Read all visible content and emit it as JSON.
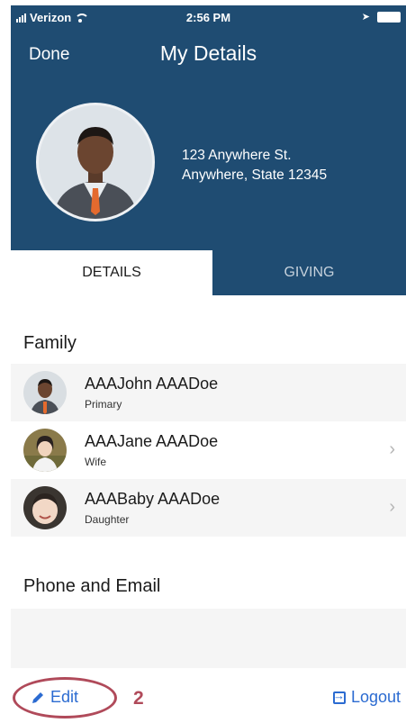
{
  "status_bar": {
    "carrier": "Verizon",
    "time": "2:56 PM",
    "icons": [
      "signal-icon",
      "wifi-icon",
      "location-arrow-icon",
      "battery-icon"
    ]
  },
  "nav": {
    "done_label": "Done",
    "title": "My Details"
  },
  "profile": {
    "address_line1": "123 Anywhere St.",
    "address_line2": "Anywhere, State 12345"
  },
  "tabs": [
    {
      "label": "DETAILS",
      "active": true
    },
    {
      "label": "GIVING",
      "active": false
    }
  ],
  "sections": {
    "family_title": "Family",
    "phone_email_title": "Phone and Email"
  },
  "family": [
    {
      "name": "AAAJohn AAADoe",
      "role": "Primary",
      "chevron": false
    },
    {
      "name": "AAAJane AAADoe",
      "role": "Wife",
      "chevron": true
    },
    {
      "name": "AAABaby AAADoe",
      "role": "Daughter",
      "chevron": true
    }
  ],
  "toolbar": {
    "edit_label": "Edit",
    "logout_label": "Logout",
    "annotation_number": "2"
  },
  "colors": {
    "header_bg": "#1f4c72",
    "link_blue": "#2b6bd1",
    "annotation": "#b04a5a",
    "row_shade": "#f5f5f5"
  }
}
